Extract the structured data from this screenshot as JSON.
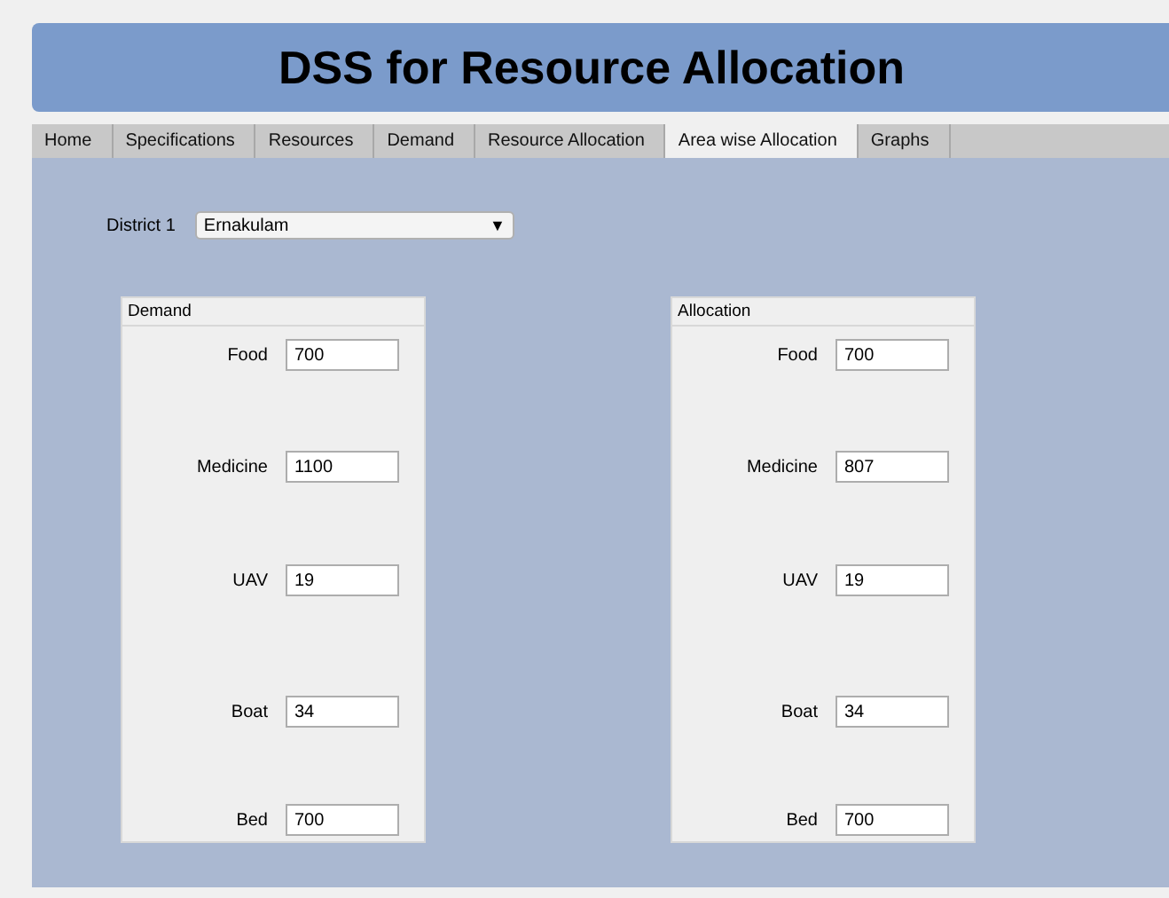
{
  "header": {
    "title": "DSS for Resource Allocation"
  },
  "tabs": [
    {
      "label": "Home",
      "selected": false
    },
    {
      "label": "Specifications",
      "selected": false
    },
    {
      "label": "Resources",
      "selected": false
    },
    {
      "label": "Demand",
      "selected": false
    },
    {
      "label": "Resource Allocation",
      "selected": false
    },
    {
      "label": "Area wise Allocation",
      "selected": true
    },
    {
      "label": "Graphs",
      "selected": false
    }
  ],
  "district": {
    "label": "District 1",
    "value": "Ernakulam",
    "arrow": "▼"
  },
  "panels": [
    {
      "title": "Demand",
      "fields": [
        {
          "label": "Food",
          "value": "700"
        },
        {
          "label": "Medicine",
          "value": "1100"
        },
        {
          "label": "UAV",
          "value": "19"
        },
        {
          "label": "Boat",
          "value": "34"
        },
        {
          "label": "Bed",
          "value": "700"
        }
      ]
    },
    {
      "title": "Allocation",
      "fields": [
        {
          "label": "Food",
          "value": "700"
        },
        {
          "label": "Medicine",
          "value": "807"
        },
        {
          "label": "UAV",
          "value": "19"
        },
        {
          "label": "Boat",
          "value": "34"
        },
        {
          "label": "Bed",
          "value": "700"
        }
      ]
    }
  ]
}
